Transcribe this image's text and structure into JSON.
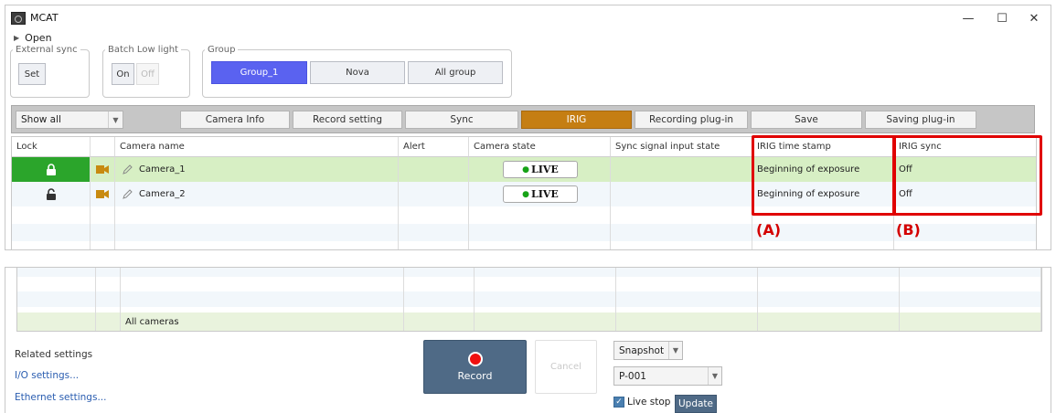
{
  "window": {
    "title": "MCAT",
    "minimize": "—",
    "maximize": "☐",
    "close": "✕"
  },
  "open_label": "Open",
  "groups": {
    "external_sync": {
      "legend": "External sync",
      "button": "Set"
    },
    "batch_low_light": {
      "legend": "Batch Low light",
      "on": "On",
      "off": "Off"
    },
    "group": {
      "legend": "Group",
      "buttons": [
        "Group_1",
        "Nova",
        "All group"
      ],
      "selected": "Group_1"
    }
  },
  "toolbar": {
    "filter": "Show all",
    "tabs": [
      "Camera Info",
      "Record setting",
      "Sync",
      "IRIG",
      "Recording plug-in",
      "Save",
      "Saving plug-in"
    ],
    "active_tab": "IRIG"
  },
  "table": {
    "headers": [
      "Lock",
      "",
      "Camera name",
      "Alert",
      "Camera state",
      "Sync signal input state",
      "IRIG time stamp",
      "IRIG sync"
    ],
    "rows": [
      {
        "name": "Camera_1",
        "state": "LIVE",
        "irig_time_stamp": "Beginning of exposure",
        "irig_sync": "Off",
        "locked": true
      },
      {
        "name": "Camera_2",
        "state": "LIVE",
        "irig_time_stamp": "Beginning of exposure",
        "irig_sync": "Off",
        "locked": false
      }
    ],
    "footer_label": "All cameras"
  },
  "annotations": {
    "a": "(A)",
    "b": "(B)",
    "color": "#e00000"
  },
  "bottom": {
    "related_settings": "Related settings",
    "io_settings": "I/O settings...",
    "ethernet_settings": "Ethernet settings...",
    "record": "Record",
    "cancel": "Cancel",
    "snapshot": "Snapshot",
    "preset": "P-001",
    "live_stop": "Live stop",
    "update": "Update"
  },
  "colors": {
    "group_active": "#5a62f0",
    "tab_active": "#c57e13",
    "row_selected": "#d7efc4",
    "lock_active": "#2ba52b",
    "camera_icon": "#c88a10",
    "link": "#2a5db0"
  }
}
